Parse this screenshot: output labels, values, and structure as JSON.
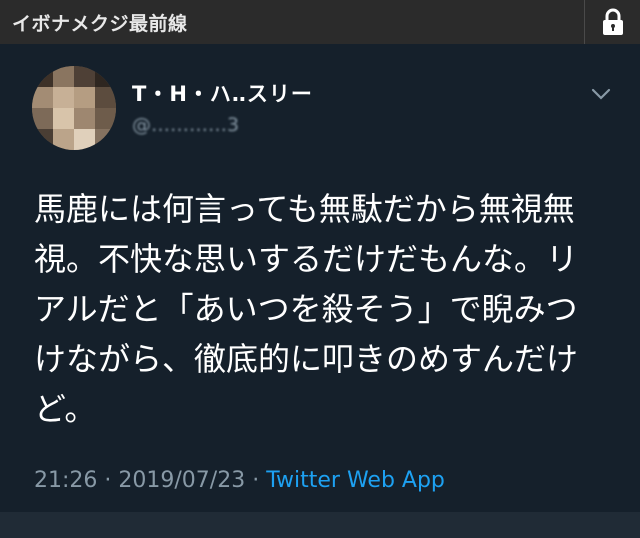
{
  "header": {
    "title": "イボナメクジ最前線",
    "lock_icon": "lock-icon"
  },
  "tweet": {
    "display_name": "T・H・ハ‥スリー",
    "handle": "@…………3",
    "text": "馬鹿には何言っても無駄だから無視無視。不快な思いするだけだもんな。リアルだと「あいつを殺そう」で睨みつけながら、徹底的に叩きのめすんだけど。",
    "time": "21:26",
    "separator": "·",
    "date": "2019/07/23",
    "source": "Twitter Web App",
    "menu_icon": "chevron-down-icon"
  },
  "colors": {
    "background": "#15202b",
    "header_bar": "#2b2b2b",
    "link": "#1da1f2",
    "muted": "#8899a6"
  }
}
